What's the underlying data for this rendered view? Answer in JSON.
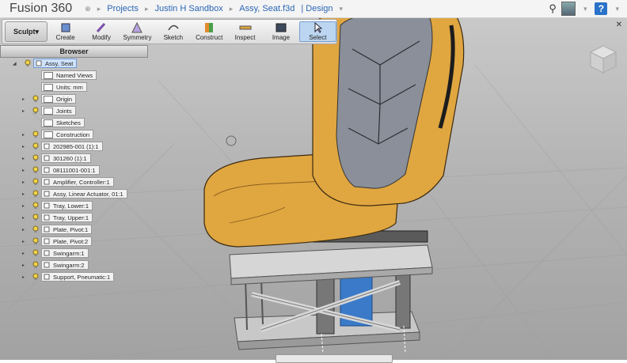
{
  "app": {
    "title": "Fusion 360"
  },
  "breadcrumbs": {
    "projects": "Projects",
    "project": "Justin H Sandbox",
    "document": "Assy, Seat.f3d",
    "workspace": "| Design"
  },
  "toolbar": {
    "workspace": "Sculpt",
    "tools": [
      "Create",
      "Modify",
      "Symmetry",
      "Sketch",
      "Construct",
      "Inspect",
      "Image",
      "Select"
    ]
  },
  "browser": {
    "title": "Browser",
    "root": "Assy, Seat",
    "items": [
      "Named Views",
      "Units: mm",
      "Origin",
      "Joints",
      "Sketches",
      "Construction",
      "202985-001 (1):1",
      "301260 (1):1",
      "08111001-001:1",
      "Amplifier, Controller:1",
      "Assy, Linear Actuator, 01:1",
      "Tray, Lower:1",
      "Tray, Upper:1",
      "Plate, Pivot:1",
      "Plate, Pivot:2",
      "Swingarm:1",
      "Swingarm:2",
      "Support, Pneumatic:1"
    ]
  },
  "colors": {
    "accent": "#2a66b5",
    "seat": "#e0a640",
    "insert": "#8a8f99",
    "selection": "#cfe2fb"
  },
  "icons": [
    "search-icon",
    "user-avatar",
    "help-icon",
    "close-icon",
    "viewcube"
  ]
}
